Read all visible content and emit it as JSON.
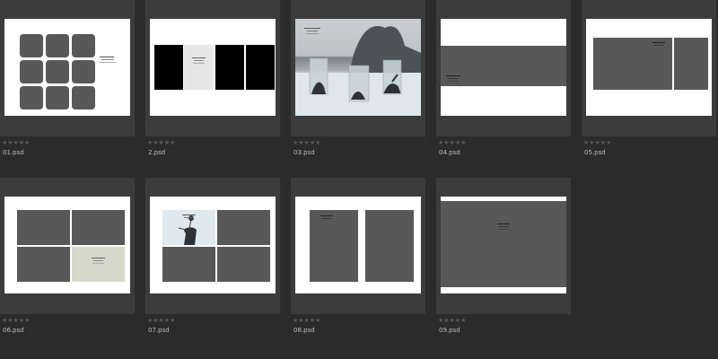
{
  "colors": {
    "background": "#2b2b2b",
    "tile": "#3c3c3c",
    "placeholder": "#585858",
    "star": "#5a5a5a",
    "label": "#bdbdbd"
  },
  "rating_glyphs": "★★★★★",
  "files": [
    {
      "name": "01.psd"
    },
    {
      "name": "2.psd"
    },
    {
      "name": "03.psd"
    },
    {
      "name": "04.psd"
    },
    {
      "name": "05.psd"
    },
    {
      "name": "06.psd"
    },
    {
      "name": "07.psd"
    },
    {
      "name": "08.psd"
    },
    {
      "name": "09.psd"
    }
  ]
}
